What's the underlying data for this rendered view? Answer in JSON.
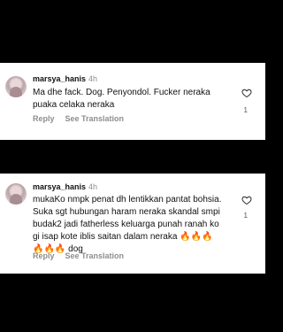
{
  "comments": [
    {
      "username": "marsya_hanis",
      "time": "4h",
      "text": "Ma dhe fack. Dog. Penyondol. Fucker neraka\npuaka celaka neraka",
      "reply_label": "Reply",
      "translation_label": "See Translation",
      "likes": "1"
    },
    {
      "username": "marsya_hanis",
      "time": "4h",
      "text": "mukaKo nmpk penat dh lentikkan pantat bohsia.\nSuka sgt hubungan haram neraka skandal smpi\nbudak2 jadi fatherless keluarga punah ranah ko\ngi isap kote iblis saitan dalam neraka 🔥🔥🔥\n🔥🔥🔥 dog",
      "reply_label": "Reply",
      "translation_label": "See Translation",
      "likes": "1"
    }
  ],
  "icons": {
    "like": "heart-outline-icon",
    "avatar": "profile-avatar"
  },
  "colors": {
    "background": "#000000",
    "card": "#ffffff",
    "muted": "#8e8e8e"
  }
}
